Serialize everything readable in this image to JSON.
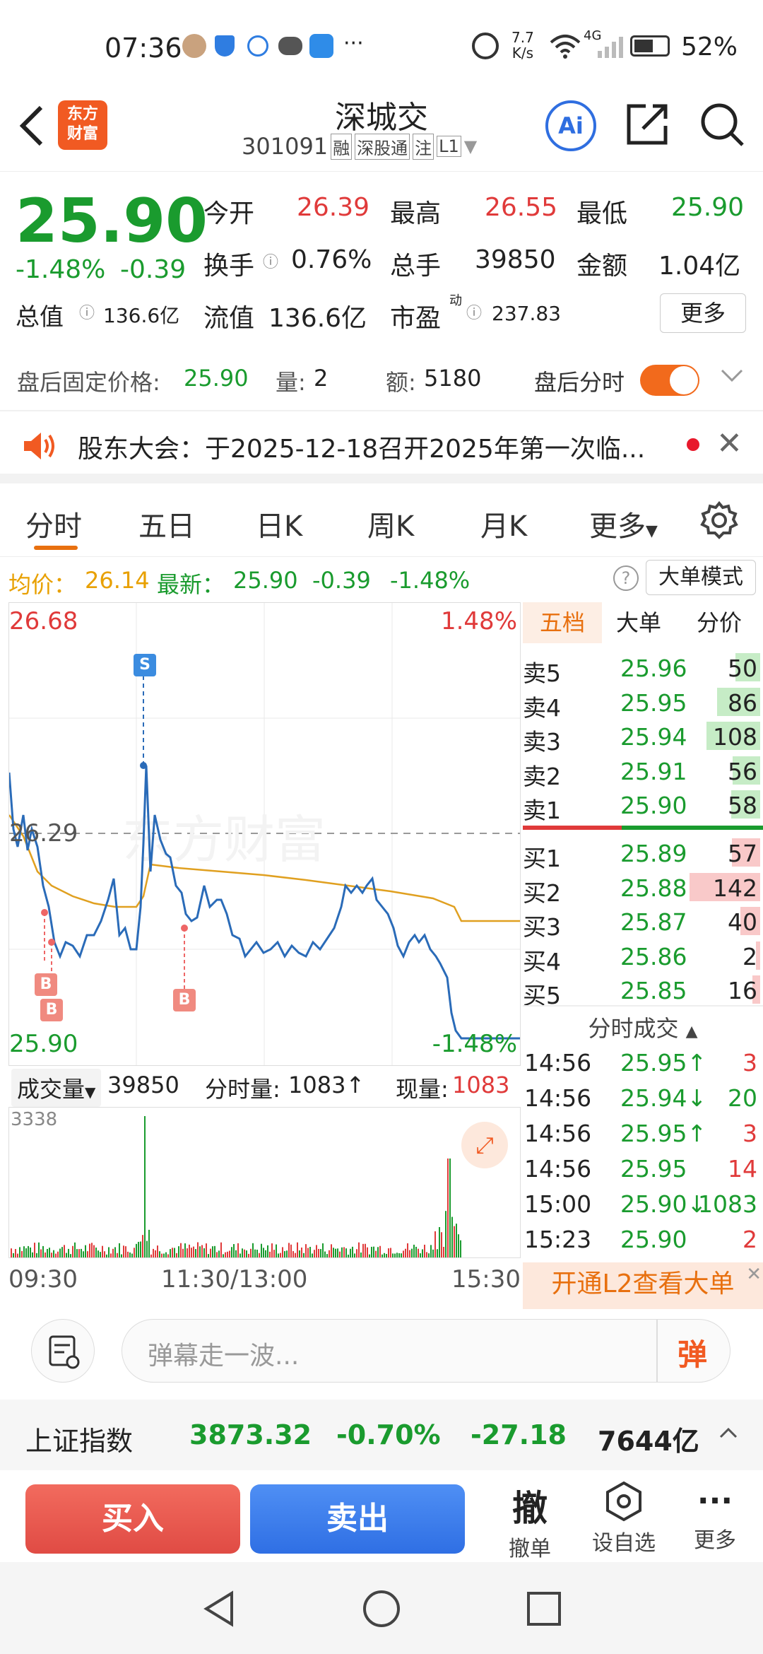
{
  "status": {
    "time": "07:36",
    "speed_top": "7.7",
    "speed_bottom": "K/s",
    "network": "4G",
    "battery": "52%"
  },
  "header": {
    "title": "深城交",
    "code": "301091",
    "tags": [
      "融",
      "深股通",
      "注",
      "L1"
    ],
    "logo_line1": "东方",
    "logo_line2": "财富",
    "ai_label": "Ai"
  },
  "quote": {
    "price": "25.90",
    "change_pct": "-1.48%",
    "change": "-0.39",
    "open_label": "今开",
    "open": "26.39",
    "high_label": "最高",
    "high": "26.55",
    "low_label": "最低",
    "low": "25.90",
    "turnover_label": "换手",
    "turnover": "0.76%",
    "volume_label": "总手",
    "volume": "39850",
    "amount_label": "金额",
    "amount": "1.04亿",
    "mktcap_label": "总值",
    "mktcap": "136.6亿",
    "float_label": "流值",
    "float": "136.6亿",
    "pe_label": "市盈",
    "pe_sup": "动",
    "pe": "237.83",
    "more_label": "更多"
  },
  "afterhours": {
    "price_label": "盘后固定价格:",
    "price": "25.90",
    "vol_label": "量:",
    "vol": "2",
    "amt_label": "额:",
    "amt": "5180",
    "toggle_label": "盘后分时"
  },
  "notice": {
    "text": "股东大会：于2025-12-18召开2025年第一次临..."
  },
  "tabs": [
    {
      "label": "分时"
    },
    {
      "label": "五日"
    },
    {
      "label": "日K"
    },
    {
      "label": "周K"
    },
    {
      "label": "月K"
    },
    {
      "label": "更多"
    }
  ],
  "infobar": {
    "avg_label": "均价：",
    "avg": "26.14",
    "last_label": "最新：",
    "last": "25.90",
    "chg": "-0.39",
    "chgpct": "-1.48%",
    "mode_label": "大单模式"
  },
  "chart": {
    "top_price": "26.68",
    "top_pct": "1.48%",
    "mid_price": "26.29",
    "bottom_price": "25.90",
    "bottom_pct": "-1.48%",
    "watermark": "东方财富",
    "sell_marker": "S",
    "buy_marker": "B"
  },
  "volume_bar": {
    "label": "成交量",
    "total": "39850",
    "min_label": "分时量:",
    "min_value": "1083↑",
    "cur_label": "现量:",
    "cur_value": "1083",
    "max": "3338"
  },
  "time_axis": {
    "start": "09:30",
    "mid": "11:30/13:00",
    "end": "15:30"
  },
  "orderbook": {
    "tabs": [
      "五档",
      "大单",
      "分价"
    ],
    "sells": [
      {
        "label": "卖5",
        "price": "25.96",
        "qty": "50"
      },
      {
        "label": "卖4",
        "price": "25.95",
        "qty": "86"
      },
      {
        "label": "卖3",
        "price": "25.94",
        "qty": "108"
      },
      {
        "label": "卖2",
        "price": "25.91",
        "qty": "56"
      },
      {
        "label": "卖1",
        "price": "25.90",
        "qty": "58"
      }
    ],
    "buys": [
      {
        "label": "买1",
        "price": "25.89",
        "qty": "57"
      },
      {
        "label": "买2",
        "price": "25.88",
        "qty": "142"
      },
      {
        "label": "买3",
        "price": "25.87",
        "qty": "40"
      },
      {
        "label": "买4",
        "price": "25.86",
        "qty": "2"
      },
      {
        "label": "买5",
        "price": "25.85",
        "qty": "16"
      }
    ],
    "trades_title": "分时成交",
    "trades": [
      {
        "time": "14:56",
        "price": "25.95↑",
        "qty": "3"
      },
      {
        "time": "14:56",
        "price": "25.94↓",
        "qty": "20"
      },
      {
        "time": "14:56",
        "price": "25.95↑",
        "qty": "3"
      },
      {
        "time": "14:56",
        "price": "25.95",
        "qty": "14"
      },
      {
        "time": "15:00",
        "price": "25.90↓",
        "qty": "1083"
      },
      {
        "time": "15:23",
        "price": "25.90",
        "qty": "2"
      }
    ],
    "l2_banner": "开通L2查看大单"
  },
  "danmu": {
    "placeholder": "弹幕走一波...",
    "button": "弹"
  },
  "index": {
    "name": "上证指数",
    "value": "3873.32",
    "pct": "-0.70%",
    "chg": "-27.18",
    "amount": "7644亿"
  },
  "actions": {
    "buy": "买入",
    "sell": "卖出",
    "cancel_icon": "撤",
    "cancel": "撤单",
    "watch": "设自选",
    "more": "更多"
  }
}
